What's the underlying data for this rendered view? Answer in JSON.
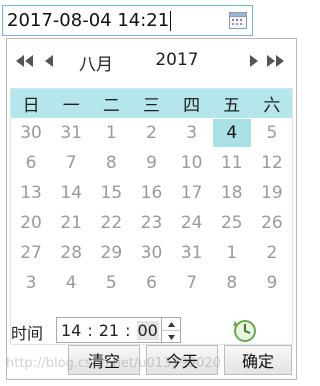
{
  "input": {
    "value": "2017-08-04 14:21"
  },
  "picker": {
    "month": "八月",
    "year": "2017",
    "weekdays": [
      "日",
      "一",
      "二",
      "三",
      "四",
      "五",
      "六"
    ],
    "weeks": [
      [
        "30",
        "31",
        "1",
        "2",
        "3",
        "4",
        "5"
      ],
      [
        "6",
        "7",
        "8",
        "9",
        "10",
        "11",
        "12"
      ],
      [
        "13",
        "14",
        "15",
        "16",
        "17",
        "18",
        "19"
      ],
      [
        "20",
        "21",
        "22",
        "23",
        "24",
        "25",
        "26"
      ],
      [
        "27",
        "28",
        "29",
        "30",
        "31",
        "1",
        "2"
      ],
      [
        "3",
        "4",
        "5",
        "6",
        "7",
        "8",
        "9"
      ]
    ],
    "selected_day": "4",
    "time_label": "时间",
    "time": {
      "hour": "14",
      "minute": "21",
      "second": "00",
      "separator": ":"
    },
    "buttons": {
      "clear": "清空",
      "today": "今天",
      "ok": "确定"
    }
  },
  "watermark": "http://blog.csdn.net/u013299020",
  "colors": {
    "header_bg": "#b4e6eb",
    "selected_bg": "#a8e2e7",
    "input_border": "#7eaed7"
  },
  "icons": [
    "calendar-icon",
    "prev-year-icon",
    "prev-month-icon",
    "next-month-icon",
    "next-year-icon",
    "spin-up-icon",
    "spin-down-icon",
    "today-clock-icon"
  ]
}
